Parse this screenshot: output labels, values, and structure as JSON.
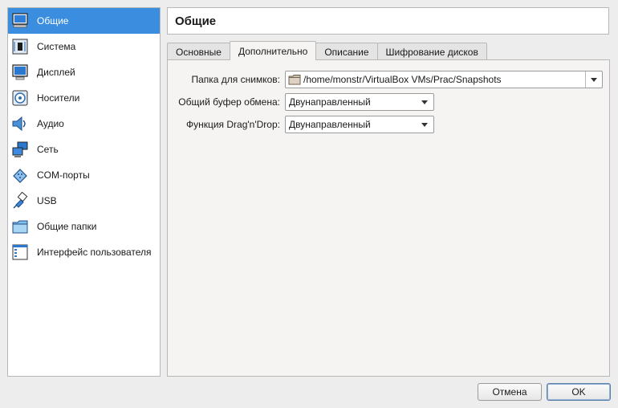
{
  "sidebar": {
    "items": [
      {
        "label": "Общие",
        "icon": "monitor-general-icon",
        "active": true
      },
      {
        "label": "Система",
        "icon": "motherboard-icon"
      },
      {
        "label": "Дисплей",
        "icon": "display-icon"
      },
      {
        "label": "Носители",
        "icon": "disk-icon"
      },
      {
        "label": "Аудио",
        "icon": "speaker-icon"
      },
      {
        "label": "Сеть",
        "icon": "network-icon"
      },
      {
        "label": "COM-порты",
        "icon": "serial-port-icon"
      },
      {
        "label": "USB",
        "icon": "usb-icon"
      },
      {
        "label": "Общие папки",
        "icon": "shared-folder-icon"
      },
      {
        "label": "Интерфейс пользователя",
        "icon": "user-interface-icon"
      }
    ]
  },
  "header": {
    "title": "Общие"
  },
  "tabs": [
    {
      "label": "Основные"
    },
    {
      "label": "Дополнительно",
      "active": true
    },
    {
      "label": "Описание"
    },
    {
      "label": "Шифрование дисков"
    }
  ],
  "advanced": {
    "snapshot_label": "Папка для снимков:",
    "snapshot_value": "/home/monstr/VirtualBox VMs/Prac/Snapshots",
    "clipboard_label": "Общий буфер обмена:",
    "clipboard_value": "Двунаправленный",
    "dnd_label": "Функция Drag'n'Drop:",
    "dnd_value": "Двунаправленный"
  },
  "buttons": {
    "cancel": "Отмена",
    "ok": "OK"
  },
  "colors": {
    "accent": "#3a8ddf"
  }
}
